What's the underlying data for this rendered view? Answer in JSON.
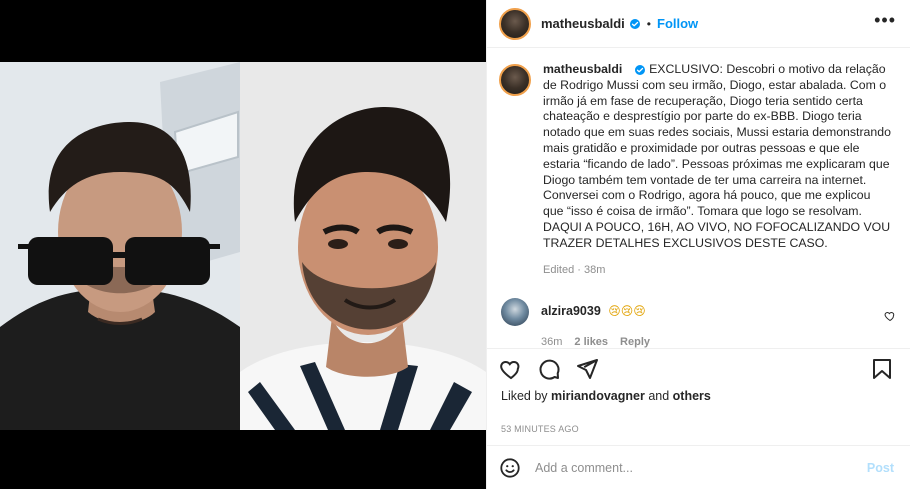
{
  "post": {
    "author": "matheusbaldi",
    "follow_label": "Follow",
    "more_label": "•••",
    "dot": "•",
    "caption": "EXCLUSIVO: Descobri o motivo da relação de Rodrigo Mussi com seu irmão, Diogo, estar abalada. Com o irmão já em fase de recuperação, Diogo teria sentido certa chateação e desprestígio por parte do ex-BBB. Diogo teria notado que em suas redes sociais, Mussi estaria demonstrando mais gratidão e proximidade por outras pessoas e que ele estaria “ficando de lado”. Pessoas próximas me explicaram que Diogo também tem vontade de ter uma carreira na internet. Conversei com o Rodrigo, agora há pouco, que me explicou que “isso é coisa de irmão”. Tomara que logo se resolvam. DAQUI A POUCO, 16H, AO VIVO, NO FOFOCALIZANDO VOU TRAZER DETALHES EXCLUSIVOS DESTE CASO.",
    "edited_meta": "Edited · 38m"
  },
  "comment": {
    "username": "alzira9039",
    "emojis": "😢😢😢",
    "time": "36m",
    "likes": "2 likes",
    "reply_label": "Reply"
  },
  "actions": {
    "liked_by_prefix": "Liked by",
    "liked_by_user": "miriandovagner",
    "liked_by_and": "and",
    "liked_by_others": "others",
    "timestamp": "53 MINUTES AGO"
  },
  "add_comment": {
    "placeholder": "Add a comment...",
    "post_label": "Post"
  },
  "icons": {
    "verified": "verified-badge-icon",
    "heart": "heart-icon",
    "comment": "comment-icon",
    "share": "share-icon",
    "save": "bookmark-icon",
    "emoji": "emoji-icon",
    "more": "more-options-icon"
  },
  "colors": {
    "link_blue": "#0095f6",
    "text": "#262626",
    "muted": "#8e8e8e",
    "post_disabled": "#b2dffc"
  }
}
